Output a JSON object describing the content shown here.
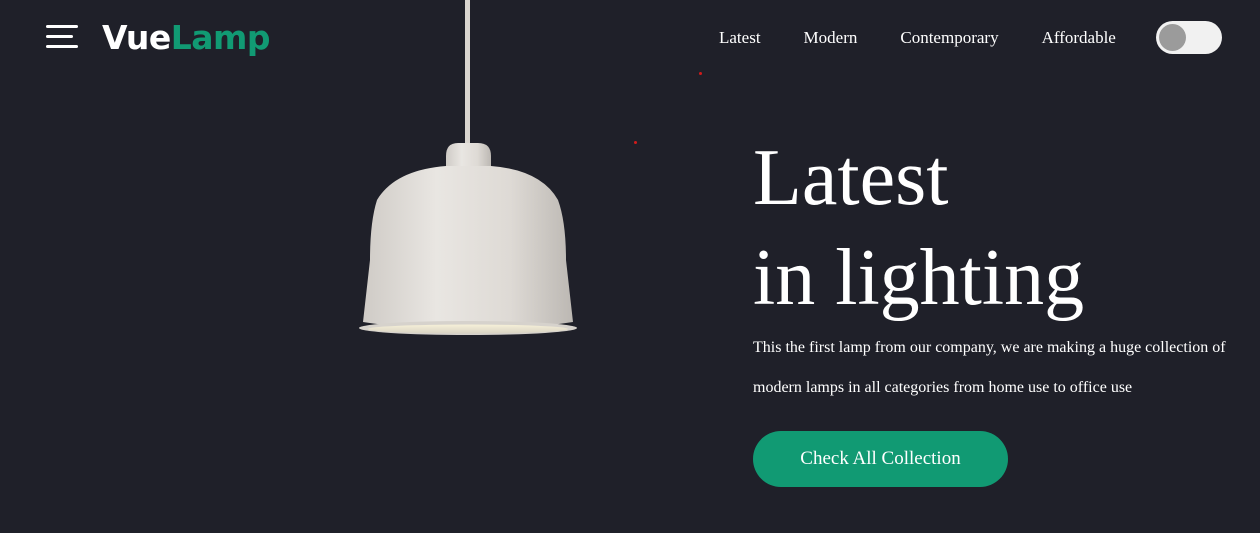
{
  "header": {
    "menu_icon": "hamburger-menu-icon",
    "logo": {
      "part1": "Vue",
      "part2": "Lamp"
    },
    "nav": [
      "Latest",
      "Modern",
      "Contemporary",
      "Affordable"
    ],
    "theme_toggle": {
      "state": "off"
    }
  },
  "hero": {
    "title_line1": "Latest",
    "title_line2": "in lighting",
    "description_line1": "This the first lamp from our company, we are making a huge collection of",
    "description_line2": "modern lamps in all categories from home use to office use",
    "cta_label": "Check All Collection",
    "image": "pendant-lamp-image"
  },
  "colors": {
    "background": "#1f2029",
    "accent": "#119a73",
    "text": "#ffffff"
  }
}
